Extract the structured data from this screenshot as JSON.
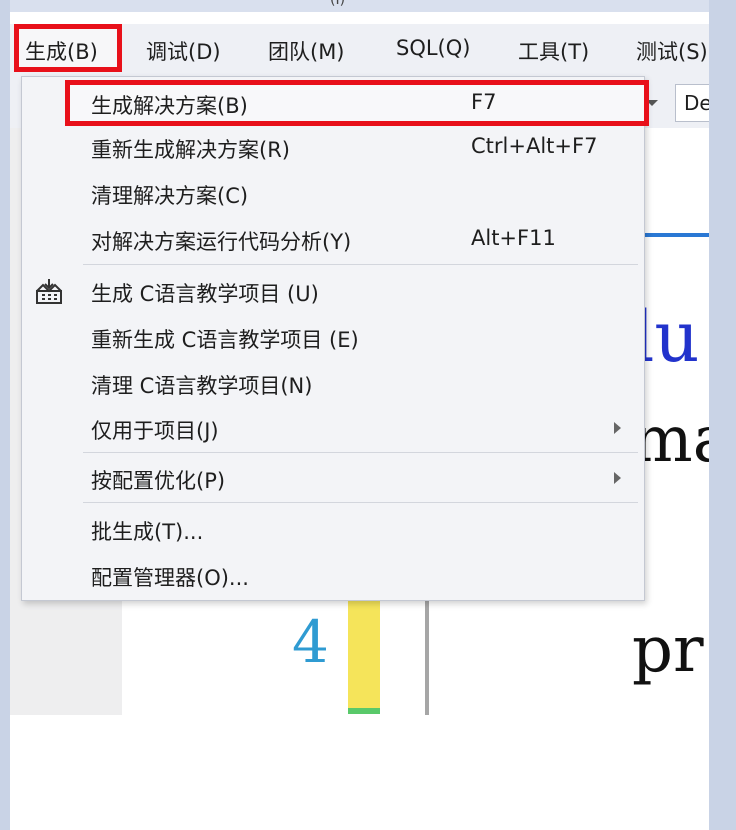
{
  "title_fragment": "(I)",
  "menubar": {
    "items": [
      "生成(B)",
      "调试(D)",
      "团队(M)",
      "SQL(Q)",
      "工具(T)",
      "测试(S)"
    ]
  },
  "toolbar": {
    "config_value": "De"
  },
  "editor": {
    "line_number": "4",
    "code_fragments": [
      "lu",
      "ma",
      "pr"
    ]
  },
  "build_menu": {
    "items": [
      {
        "label": "生成解决方案(B)",
        "shortcut": "F7"
      },
      {
        "label": "重新生成解决方案(R)",
        "shortcut": "Ctrl+Alt+F7"
      },
      {
        "label": "清理解决方案(C)",
        "shortcut": ""
      },
      {
        "label": "对解决方案运行代码分析(Y)",
        "shortcut": "Alt+F11"
      },
      {
        "label": "生成 C语言教学项目 (U)",
        "shortcut": ""
      },
      {
        "label": "重新生成 C语言教学项目 (E)",
        "shortcut": ""
      },
      {
        "label": "清理 C语言教学项目(N)",
        "shortcut": ""
      },
      {
        "label": "仅用于项目(J)",
        "shortcut": ""
      },
      {
        "label": "按配置优化(P)",
        "shortcut": ""
      },
      {
        "label": "批生成(T)...",
        "shortcut": ""
      },
      {
        "label": "配置管理器(O)...",
        "shortcut": ""
      }
    ]
  },
  "colors": {
    "highlight_border": "#e8101a",
    "menu_background": "#f3f4f7",
    "code_blue": "#2233cc",
    "line_number": "#2f9bd2"
  }
}
